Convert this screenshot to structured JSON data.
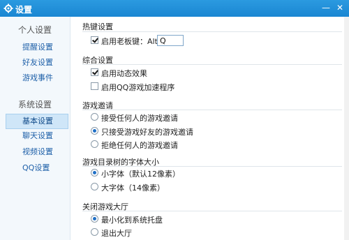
{
  "window": {
    "title": "设置",
    "icon": "gear-icon",
    "accent": "#1a86d2"
  },
  "sidebar": {
    "personal_header": "个人设置",
    "personal_items": [
      "提醒设置",
      "好友设置",
      "游戏事件"
    ],
    "system_header": "系统设置",
    "system_items": [
      "基本设置",
      "聊天设置",
      "视频设置",
      "QQ设置"
    ],
    "active": "基本设置"
  },
  "hotkey": {
    "title": "热键设置",
    "boss_key_label": "启用老板键：Alt+",
    "boss_key_checked": true,
    "boss_key_value": "Q"
  },
  "general": {
    "title": "综合设置",
    "dynamic_effects": {
      "label": "启用动态效果",
      "checked": true
    },
    "qq_accelerator": {
      "label": "启用QQ游戏加速程序",
      "checked": false
    }
  },
  "invite": {
    "title": "游戏邀请",
    "options": [
      "接受任何人的游戏邀请",
      "只接受游戏好友的游戏邀请",
      "拒绝任何人的游戏邀请"
    ],
    "selected": 1
  },
  "font_size": {
    "title": "游戏目录树的字体大小",
    "options": [
      "小字体（默认12像素）",
      "大字体（14像素）"
    ],
    "selected": 0
  },
  "close_hall": {
    "title": "关闭游戏大厅",
    "options": [
      "最小化到系统托盘",
      "退出大厅"
    ],
    "selected": 0
  }
}
